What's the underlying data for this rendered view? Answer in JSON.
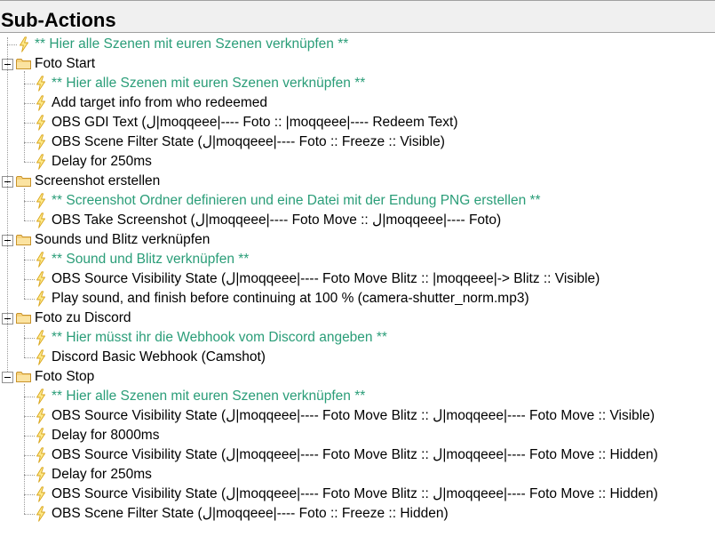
{
  "panel": {
    "title": "Sub-Actions"
  },
  "tree": {
    "top_item": {
      "label": "** Hier alle Szenen mit euren Szenen verknüpfen **",
      "icon": "lightning-icon",
      "kind": "comment"
    },
    "groups": [
      {
        "label": "Foto Start",
        "expanded": true,
        "items": [
          {
            "label": "** Hier alle Szenen mit euren Szenen verknüpfen **",
            "kind": "comment"
          },
          {
            "label": "Add target info from who redeemed",
            "kind": "action"
          },
          {
            "label": "OBS GDI Text (ﻝ|moqqeee|---- Foto :: |moqqeee|---- Redeem Text)",
            "kind": "action"
          },
          {
            "label": "OBS Scene Filter State (ﻝ|moqqeee|---- Foto :: Freeze :: Visible)",
            "kind": "action"
          },
          {
            "label": "Delay for 250ms",
            "kind": "action"
          }
        ]
      },
      {
        "label": "Screenshot erstellen",
        "expanded": true,
        "items": [
          {
            "label": "** Screenshot Ordner definieren und eine Datei mit der Endung PNG erstellen **",
            "kind": "comment"
          },
          {
            "label": "OBS Take Screenshot (ﻝ|moqqeee|---- Foto Move :: ﻝ|moqqeee|---- Foto)",
            "kind": "action"
          }
        ]
      },
      {
        "label": "Sounds und Blitz verknüpfen",
        "expanded": true,
        "items": [
          {
            "label": "** Sound und Blitz verknüpfen **",
            "kind": "comment"
          },
          {
            "label": "OBS Source Visibility State (ﻝ|moqqeee|---- Foto Move Blitz :: |moqqeee|-> Blitz :: Visible)",
            "kind": "action"
          },
          {
            "label": "Play sound, and finish before continuing at 100 % (camera-shutter_norm.mp3)",
            "kind": "action"
          }
        ]
      },
      {
        "label": "Foto zu Discord",
        "expanded": true,
        "items": [
          {
            "label": "** Hier müsst ihr die Webhook vom Discord angeben **",
            "kind": "comment"
          },
          {
            "label": "Discord Basic Webhook (Camshot)",
            "kind": "action"
          }
        ]
      },
      {
        "label": "Foto Stop",
        "expanded": true,
        "items": [
          {
            "label": "** Hier alle Szenen mit euren Szenen verknüpfen **",
            "kind": "comment"
          },
          {
            "label": "OBS Source Visibility State (ﻝ|moqqeee|---- Foto Move Blitz :: ﻝ|moqqeee|---- Foto Move :: Visible)",
            "kind": "action"
          },
          {
            "label": "Delay for 8000ms",
            "kind": "action"
          },
          {
            "label": "OBS Source Visibility State (ﻝ|moqqeee|---- Foto Move Blitz :: ﻝ|moqqeee|---- Foto Move :: Hidden)",
            "kind": "action"
          },
          {
            "label": "Delay for 250ms",
            "kind": "action"
          },
          {
            "label": "OBS Source Visibility State (ﻝ|moqqeee|---- Foto Move Blitz :: ﻝ|moqqeee|---- Foto Move :: Hidden)",
            "kind": "action"
          },
          {
            "label": "OBS Scene Filter State (ﻝ|moqqeee|---- Foto :: Freeze :: Hidden)",
            "kind": "action"
          }
        ]
      }
    ]
  },
  "icons": {
    "group": "folder-icon",
    "item": "lightning-icon",
    "toggle": "collapse-toggle-icon"
  },
  "colors": {
    "comment_text": "#2a9d78",
    "action_text": "#000000",
    "folder_fill": "#f6d27c",
    "folder_stroke": "#c8932b",
    "bolt_fill": "#fde98a",
    "bolt_stroke": "#d9a51b",
    "header_bg": "#f0f0f0"
  }
}
